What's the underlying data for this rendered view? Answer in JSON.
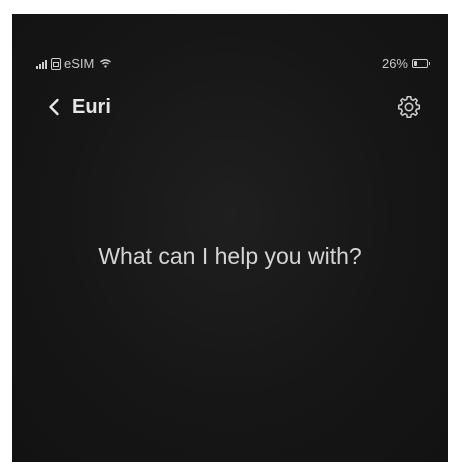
{
  "status_bar": {
    "carrier": "eSIM",
    "battery_text": "26%",
    "battery_level": 0.26
  },
  "nav": {
    "back_icon": "chevron-left-icon",
    "title": "Euri",
    "settings_icon": "gear-icon"
  },
  "main": {
    "prompt": "What can I help you with?"
  }
}
